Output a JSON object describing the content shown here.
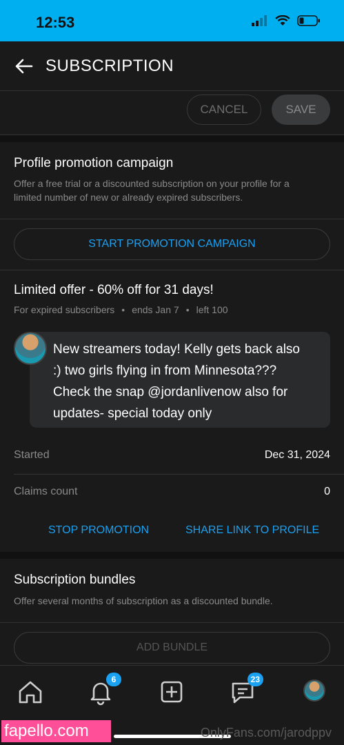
{
  "status": {
    "time": "12:53"
  },
  "header": {
    "title": "SUBSCRIPTION"
  },
  "actions": {
    "cancel": "CANCEL",
    "save": "SAVE"
  },
  "promotion": {
    "title": "Profile promotion campaign",
    "desc_line1": "Offer a free trial or a discounted subscription on your profile for a",
    "desc_line2": "limited number of new or already expired subscribers.",
    "start_button": "START PROMOTION CAMPAIGN"
  },
  "offer": {
    "title": "Limited offer - 60% off for 31 days!",
    "audience": "For expired subscribers",
    "ends": "ends Jan 7",
    "left": "left 100",
    "message_lines": [
      "New streamers today! Kelly gets back also",
      ":) two girls flying in from Minnesota???",
      "Check the snap @jordanlivenow also for",
      "updates- special today only"
    ],
    "started_label": "Started",
    "started_value": "Dec 31, 2024",
    "claims_label": "Claims count",
    "claims_value": "0",
    "stop_button": "STOP PROMOTION",
    "share_button": "SHARE LINK TO PROFILE"
  },
  "bundles": {
    "title": "Subscription bundles",
    "desc": "Offer several months of subscription as a discounted bundle.",
    "add_button": "ADD BUNDLE"
  },
  "tabbar": {
    "notifications_badge": "6",
    "messages_badge": "23"
  },
  "watermark": {
    "left": "fapello.com",
    "right": "OnlyFans.com/jarodppv"
  },
  "colors": {
    "accent": "#1ba1f2",
    "status_bar": "#00aff0",
    "background": "#1a1a1a"
  }
}
